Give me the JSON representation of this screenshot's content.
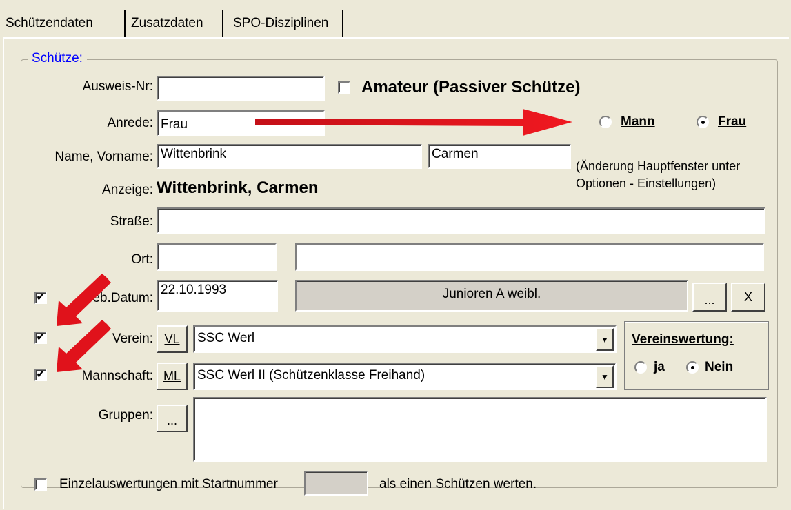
{
  "tabs": [
    "Schützendaten",
    "Zusatzdaten",
    "SPO-Disziplinen"
  ],
  "group_title": "Schütze:",
  "ausweis": {
    "label": "Ausweis-Nr:",
    "value": ""
  },
  "amateur": {
    "label": "Amateur (Passiver Schütze)",
    "checked": false
  },
  "anrede": {
    "label": "Anrede:",
    "value": "Frau"
  },
  "gender": {
    "mann_label": "Mann",
    "frau_label": "Frau",
    "selected": "Frau"
  },
  "name": {
    "label": "Name, Vorname:",
    "lastname": "Wittenbrink",
    "firstname": "Carmen"
  },
  "hint": {
    "line1": "(Änderung Hauptfenster unter",
    "line2": "Optionen - Einstellungen)"
  },
  "anzeige": {
    "label": "Anzeige:",
    "value": "Wittenbrink, Carmen"
  },
  "strasse": {
    "label": "Straße:",
    "value": ""
  },
  "ort": {
    "label": "Ort:",
    "plz": "",
    "city": ""
  },
  "geb": {
    "label": "Geb.Datum:",
    "value": "22.10.1993",
    "klasse": "Junioren A weibl.",
    "checked": true,
    "more_button": "...",
    "clear_button": "X"
  },
  "verein": {
    "label": "Verein:",
    "button": "VL",
    "value": "SSC Werl",
    "checked": true
  },
  "mannschaft": {
    "label": "Mannschaft:",
    "button": "ML",
    "value": "SSC Werl II (Schützenklasse Freihand)",
    "checked": true
  },
  "vereinswertung": {
    "title": "Vereinswertung:",
    "ja": "ja",
    "nein": "Nein",
    "selected": "Nein"
  },
  "gruppen": {
    "label": "Gruppen:",
    "button": "...",
    "value": ""
  },
  "einzel": {
    "label_before": "Einzelauswertungen mit Startnummer",
    "label_after": "als einen Schützen werten.",
    "value": "",
    "checked": false
  },
  "colors": {
    "arrow": "#e0121b",
    "group_title": "#0000ff"
  }
}
